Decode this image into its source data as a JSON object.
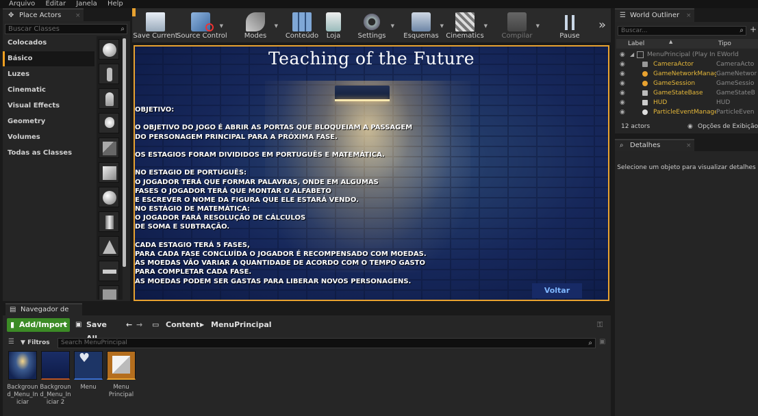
{
  "menu": [
    "Arquivo",
    "Editar",
    "Janela",
    "Help"
  ],
  "place_actors": {
    "tab_title": "Place Actors",
    "search_placeholder": "Buscar Classes",
    "categories": [
      "Colocados Recentemente",
      "Básico",
      "Luzes",
      "Cinematic",
      "Visual Effects",
      "Geometry",
      "Volumes",
      "Todas as Classes"
    ],
    "active_category": "Básico"
  },
  "toolbar": {
    "buttons": [
      {
        "label": "Save Current",
        "icon": "save-icon"
      },
      {
        "label": "Source Control",
        "icon": "source-control-icon"
      },
      {
        "label": "Modes",
        "icon": "modes-icon"
      },
      {
        "label": "Conteúdo",
        "icon": "content-icon"
      },
      {
        "label": "Loja",
        "icon": "marketplace-icon"
      },
      {
        "label": "Settings",
        "icon": "settings-icon"
      },
      {
        "label": "Esquemas",
        "icon": "blueprints-icon"
      },
      {
        "label": "Cinematics",
        "icon": "cinematics-icon"
      },
      {
        "label": "Compilar",
        "icon": "compile-icon"
      },
      {
        "label": "Pause",
        "icon": "pause-icon"
      }
    ],
    "more": "»"
  },
  "viewport": {
    "title": "Teaching of the Future",
    "lines": [
      "OBJETIVO:",
      "",
      "O OBJETIVO DO JOGO É ABRIR AS PORTAS QUE BLOQUEIAM A PASSAGEM",
      "DO PERSONAGEM PRINCIPAL PARA A PRÓXIMA FASE.",
      "",
      "OS ESTAGIOS FORAM DIVIDIDOS EM PORTUGUÊS E MATEMÁTICA.",
      "",
      "NO ESTAGIO DE PORTUGUÊS:",
      "O JOGADOR TERÁ QUE FORMAR PALAVRAS, ONDE EM ALGUMAS",
      "FASES O JOGADOR TERÁ QUE MONTAR O ALFABETO",
      "E ESCREVER O NOME DA FIGURA QUE ELE ESTARÁ VENDO.",
      "NO ESTÁGIO DE MATEMÁTICA:",
      "O JOGADOR FARÁ RESOLUÇÃO DE CÁLCULOS",
      "DE SOMA E SUBTRAÇÃO.",
      "",
      "CADA ESTAGIO TERÁ 5 FASES,",
      "PARA CADA FASE CONCLUÍDA O JOGADOR É RECOMPENSADO COM MOEDAS.",
      "AS MOEDAS VÃO VARIAR A QUANTIDADE DE ACORDO COM O TEMPO GASTO",
      "PARA COMPLETAR CADA FASE.",
      "AS MOEDAS PODEM SER GASTAS PARA LIBERAR NOVOS PERSONAGENS."
    ],
    "back_button": "Voltar"
  },
  "world_outliner": {
    "tab_title": "World Outliner",
    "search_placeholder": "Buscar...",
    "col_label": "Label",
    "col_type": "Tipo",
    "root": "MenuPrincipal (Play In EWorld",
    "rows": [
      {
        "name": "CameraActor",
        "type": "CameraActo"
      },
      {
        "name": "GameNetworkManage",
        "type": "GameNetwor"
      },
      {
        "name": "GameSession",
        "type": "GameSessio"
      },
      {
        "name": "GameStateBase",
        "type": "GameStateB"
      },
      {
        "name": "HUD",
        "type": "HUD"
      },
      {
        "name": "ParticleEventManager",
        "type": "ParticleEven"
      }
    ],
    "count": "12 actors",
    "view_options": "Opções de Exibição"
  },
  "details": {
    "tab_title": "Detalhes",
    "message": "Selecione um objeto para visualizar detalhes"
  },
  "content_browser": {
    "tab_title": "Navegador de Con",
    "add_import": "Add/Import",
    "save_all": "Save All",
    "crumb_root": "Content",
    "crumb_current": "MenuPrincipal",
    "filters": "Filtros",
    "search_placeholder": "Search MenuPrincipal",
    "assets": [
      {
        "label": "Background_Menu_Iniciar"
      },
      {
        "label": "Background_Menu_Iniciar 2"
      },
      {
        "label": "Menu"
      },
      {
        "label": "Menu Principal"
      }
    ]
  },
  "colors": {
    "accent": "#e8a230",
    "add_import_bg": "#3c8b26",
    "actor_name": "#e7b93a"
  }
}
